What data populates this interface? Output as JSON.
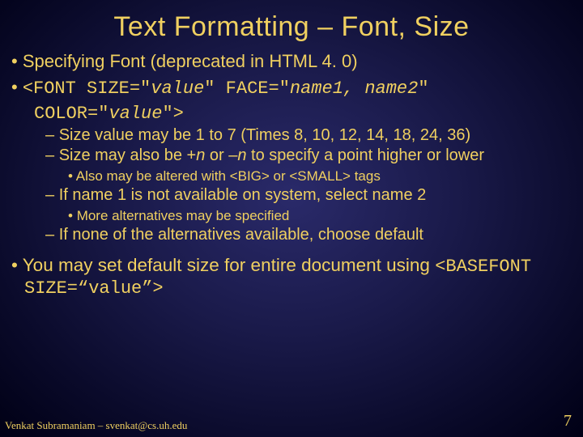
{
  "title": "Text Formatting – Font, Size",
  "bullet1": "Specifying Font (deprecated in HTML 4. 0)",
  "code_line1_a": "<FONT SIZE=\"",
  "code_line1_b": "value",
  "code_line1_c": "\" FACE=\"",
  "code_line1_d": "name1, name2",
  "code_line1_e": "\"",
  "code_line2_a": "COLOR=\"",
  "code_line2_b": "value",
  "code_line2_c": "\">",
  "sub1_a": "Size value may be 1 to 7 (Times 8, 10, 12, 14, 18, 24, 36)",
  "sub2_a": "Size may also be +",
  "sub2_b": "n",
  "sub2_c": " or –",
  "sub2_d": "n",
  "sub2_e": " to specify a point higher or lower",
  "sub2_1": "Also may be altered with <BIG> or <SMALL> tags",
  "sub3": "If name 1 is not available on system, select name 2",
  "sub3_1": "More alternatives may be specified",
  "sub4": "If none of the alternatives available, choose default",
  "bottom_a": "You may set default size for entire document using ",
  "bottom_b": "<BASEFONT SIZE=“value”>",
  "footer": "Venkat Subramaniam – svenkat@cs.uh.edu",
  "page": "7"
}
